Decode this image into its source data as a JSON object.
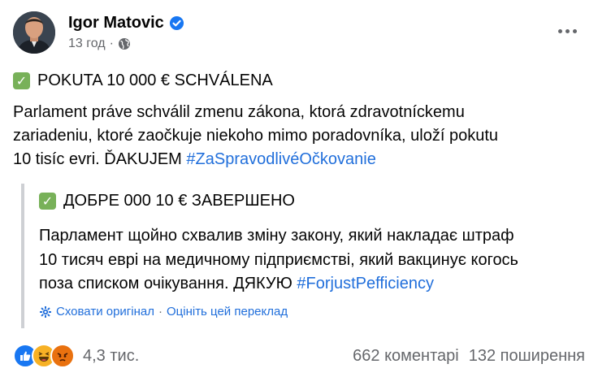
{
  "post": {
    "author": "Igor Matovic",
    "time": "13 год",
    "meta_separator": "·",
    "title": "POKUTA 10 000 € SCHVÁLENA",
    "body_lines": [
      "Parlament práve schválil zmenu zákona, ktorá zdravotníckemu",
      "zariadeniu, ktoré zaočkuje niekoho mimo poradovníka, uloží pokutu",
      "10 tisíc evri. ĎAKUJEM "
    ],
    "hashtag": "#ZaSpravodlivéOčkovanie"
  },
  "translation": {
    "title": "ДОБРЕ 000 10 € ЗАВЕРШЕНО",
    "body_lines": [
      "Парламент щойно схвалив зміну закону, який накладає штраф",
      "10 тисяч еврі на медичному підприємстві, який вакцинує когось",
      "поза списком очікування. ДЯКУЮ "
    ],
    "hashtag": "#ForjustPefficiency",
    "hide_original": "Сховати оригінал",
    "separator": "·",
    "rate_translation": "Оцініть цей переклад"
  },
  "footer": {
    "reaction_count": "4,3 тис.",
    "comments": "662 коментарі",
    "shares": "132 поширення"
  },
  "colors": {
    "link": "#216fdb",
    "secondary_text": "#65676b",
    "verified": "#1877f2",
    "check_green": "#78b159"
  }
}
